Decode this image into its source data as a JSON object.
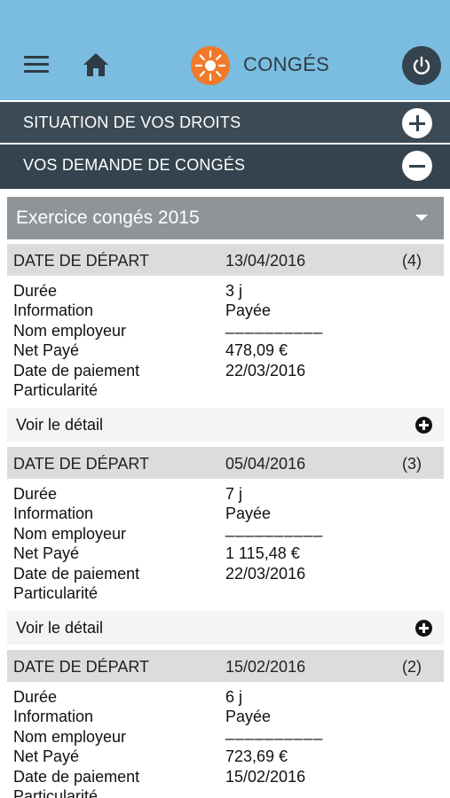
{
  "header": {
    "title": "CONGÉS"
  },
  "sections": [
    {
      "label": "SITUATION DE VOS DROITS",
      "state": "collapsed"
    },
    {
      "label": "VOS DEMANDE DE CONGÉS",
      "state": "expanded"
    }
  ],
  "year_select": {
    "value": "Exercice congés 2015"
  },
  "labels": {
    "header_key": "DATE DE DÉPART",
    "duree": "Durée",
    "information": "Information",
    "nom_employeur": "Nom employeur",
    "net_paye": "Net Payé",
    "date_paiement": "Date de paiement",
    "particularite": "Particularité",
    "voir_detail": "Voir le détail"
  },
  "entries": [
    {
      "date": "13/04/2016",
      "index": "(4)",
      "duree": "3 j",
      "information": "Payée",
      "nom_employeur": "__________",
      "net_paye": "478,09 €",
      "date_paiement": "22/03/2016",
      "particularite": ""
    },
    {
      "date": "05/04/2016",
      "index": "(3)",
      "duree": "7 j",
      "information": "Payée",
      "nom_employeur": "__________",
      "net_paye": "1 115,48 €",
      "date_paiement": "22/03/2016",
      "particularite": ""
    },
    {
      "date": "15/02/2016",
      "index": "(2)",
      "duree": "6 j",
      "information": "Payée",
      "nom_employeur": "__________",
      "net_paye": "723,69 €",
      "date_paiement": "15/02/2016",
      "particularite": ""
    }
  ],
  "icons": [
    "menu-icon",
    "home-icon",
    "sun-logo-icon",
    "power-icon",
    "plus-circle-icon",
    "minus-circle-icon",
    "caret-down-icon"
  ],
  "colors": {
    "appbar": "#7abde0",
    "section": "#34434d",
    "logo": "#f07a2a"
  }
}
